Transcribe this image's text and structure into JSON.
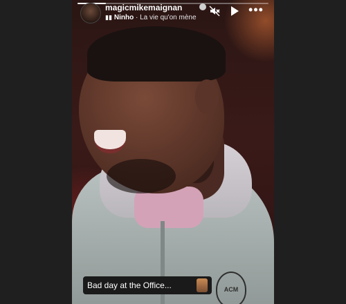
{
  "story": {
    "progress_fraction": 0.15,
    "user": {
      "username": "magicmikemaignan",
      "verified": true
    },
    "music": {
      "artist": "Ninho",
      "separator": " · ",
      "song": "La vie qu'on mène"
    },
    "controls": {
      "mute_icon": "speaker-muted-icon",
      "play_icon": "play-icon",
      "more_icon": "more-options-icon"
    },
    "caption": {
      "text": "Bad day at the Office..."
    },
    "crest_text": "ACM"
  },
  "colors": {
    "background": "#1c1c1c",
    "caption_bg": "#1a1a1a",
    "text": "#ffffff"
  }
}
